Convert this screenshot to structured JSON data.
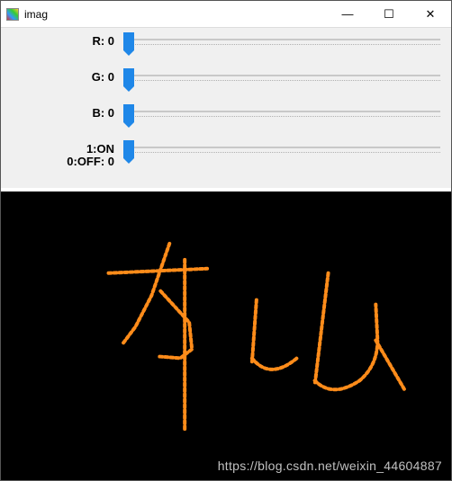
{
  "window": {
    "title": "imag",
    "buttons": {
      "min": "—",
      "max": "☐",
      "close": "✕"
    }
  },
  "trackbars": [
    {
      "label": "R: 0",
      "value": 0,
      "min": 0,
      "max": 255
    },
    {
      "label": "G: 0",
      "value": 0,
      "min": 0,
      "max": 255
    },
    {
      "label": "B: 0",
      "value": 0,
      "min": 0,
      "max": 255
    },
    {
      "label": "1:ON\n0:OFF: 0",
      "value": 0,
      "min": 0,
      "max": 1
    }
  ],
  "canvas": {
    "stroke_color": "#ff8c1a",
    "background": "#000000"
  },
  "watermark": "https://blog.csdn.net/weixin_44604887"
}
